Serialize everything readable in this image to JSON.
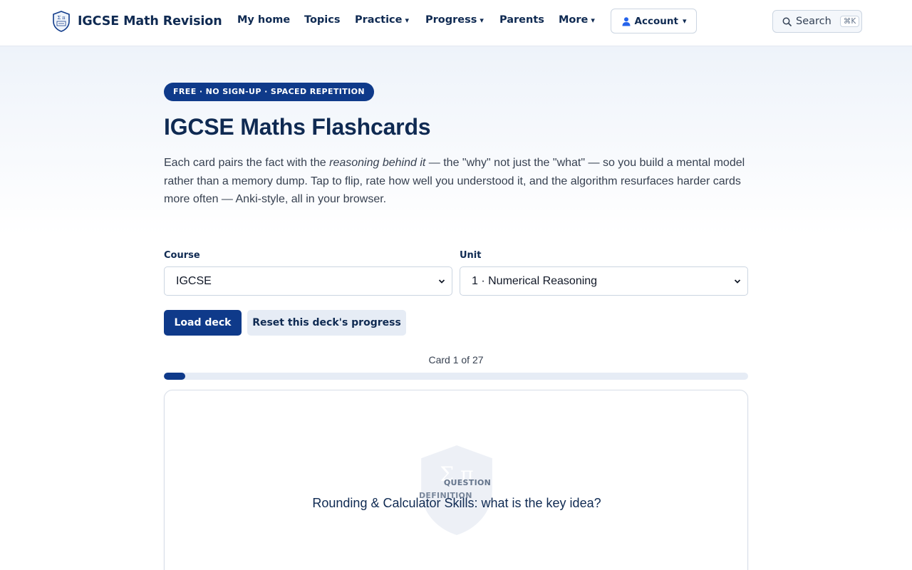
{
  "nav": {
    "brand": "IGCSE Math Revision",
    "items": [
      {
        "label": "My home",
        "dropdown": false
      },
      {
        "label": "Topics",
        "dropdown": false
      },
      {
        "label": "Practice",
        "dropdown": true
      },
      {
        "label": "Progress",
        "dropdown": true
      },
      {
        "label": "Parents",
        "dropdown": false
      },
      {
        "label": "More",
        "dropdown": true
      }
    ],
    "caret": "▾",
    "account_label": "Account",
    "search_label": "Search",
    "search_shortcut": "⌘K"
  },
  "hero": {
    "pill": "FREE · NO SIGN-UP · SPACED REPETITION",
    "title": "IGCSE Maths Flashcards",
    "lead_before": "Each card pairs the fact with the ",
    "lead_em": "reasoning behind it",
    "lead_after": " — the \"why\" not just the \"what\" — so you build a mental model rather than a memory dump. Tap to flip, rate how well you understood it, and the algorithm resurfaces harder cards more often — Anki-style, all in your browser."
  },
  "form": {
    "course_label": "Course",
    "course_value": "IGCSE",
    "unit_label": "Unit",
    "unit_value": "1 · Numerical Reasoning",
    "load_button": "Load deck",
    "reset_button": "Reset this deck's progress"
  },
  "progress": {
    "counter": "Card 1 of 27",
    "fraction": 0.037
  },
  "card": {
    "kind": "QUESTION",
    "kind_secondary": "DEFINITION",
    "text": "Rounding & Calculator Skills: what is the key idea?"
  },
  "colors": {
    "navy": "#0f2a52",
    "brand_blue": "#0f3a8a",
    "muted": "#64748b"
  }
}
